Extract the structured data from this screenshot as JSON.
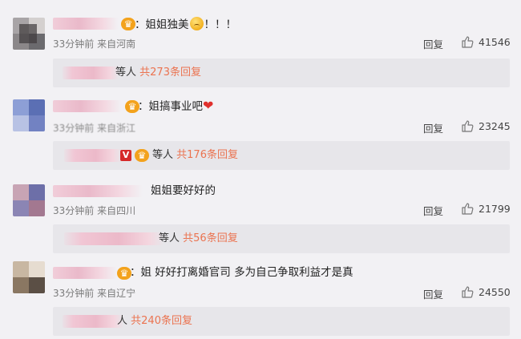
{
  "comments": [
    {
      "text_prefix": "：姐姐独美",
      "text_suffix": "！！！",
      "meta": "33分钟前 来自河南",
      "reply_label": "回复",
      "likes": "41546",
      "sub_who": "等人",
      "sub_count": "共273条回复",
      "avatar_colors": [
        "#6b6a6e",
        "#3e3b3c",
        "#8a8580",
        "#c4bfbb"
      ]
    },
    {
      "text_prefix": "：姐搞事业吧",
      "text_suffix": "",
      "meta": "33分钟前 来自浙江",
      "reply_label": "回复",
      "likes": "23245",
      "sub_who": "等人",
      "sub_count": "共176条回复",
      "avatar_colors": [
        "#5b6fb4",
        "#8d9fd6",
        "#b8c2e4",
        "#e3e5f2"
      ]
    },
    {
      "text_prefix": "姐姐要好好的",
      "text_suffix": "",
      "meta": "33分钟前 来自四川",
      "reply_label": "回复",
      "likes": "21799",
      "sub_who": "等人",
      "sub_count": "共56条回复",
      "avatar_colors": [
        "#6d6fa8",
        "#a37890",
        "#c8a4b4",
        "#e4d6de"
      ]
    },
    {
      "text_prefix": "：姐 好好打离婚官司 多为自己争取利益才是真",
      "text_suffix": "",
      "meta": "33分钟前 来自辽宁",
      "reply_label": "回复",
      "likes": "24550",
      "sub_who": "人",
      "sub_count": "共240条回复",
      "avatar_colors": [
        "#8a7762",
        "#5b4f45",
        "#c8b7a2",
        "#e6dcd0"
      ]
    }
  ]
}
